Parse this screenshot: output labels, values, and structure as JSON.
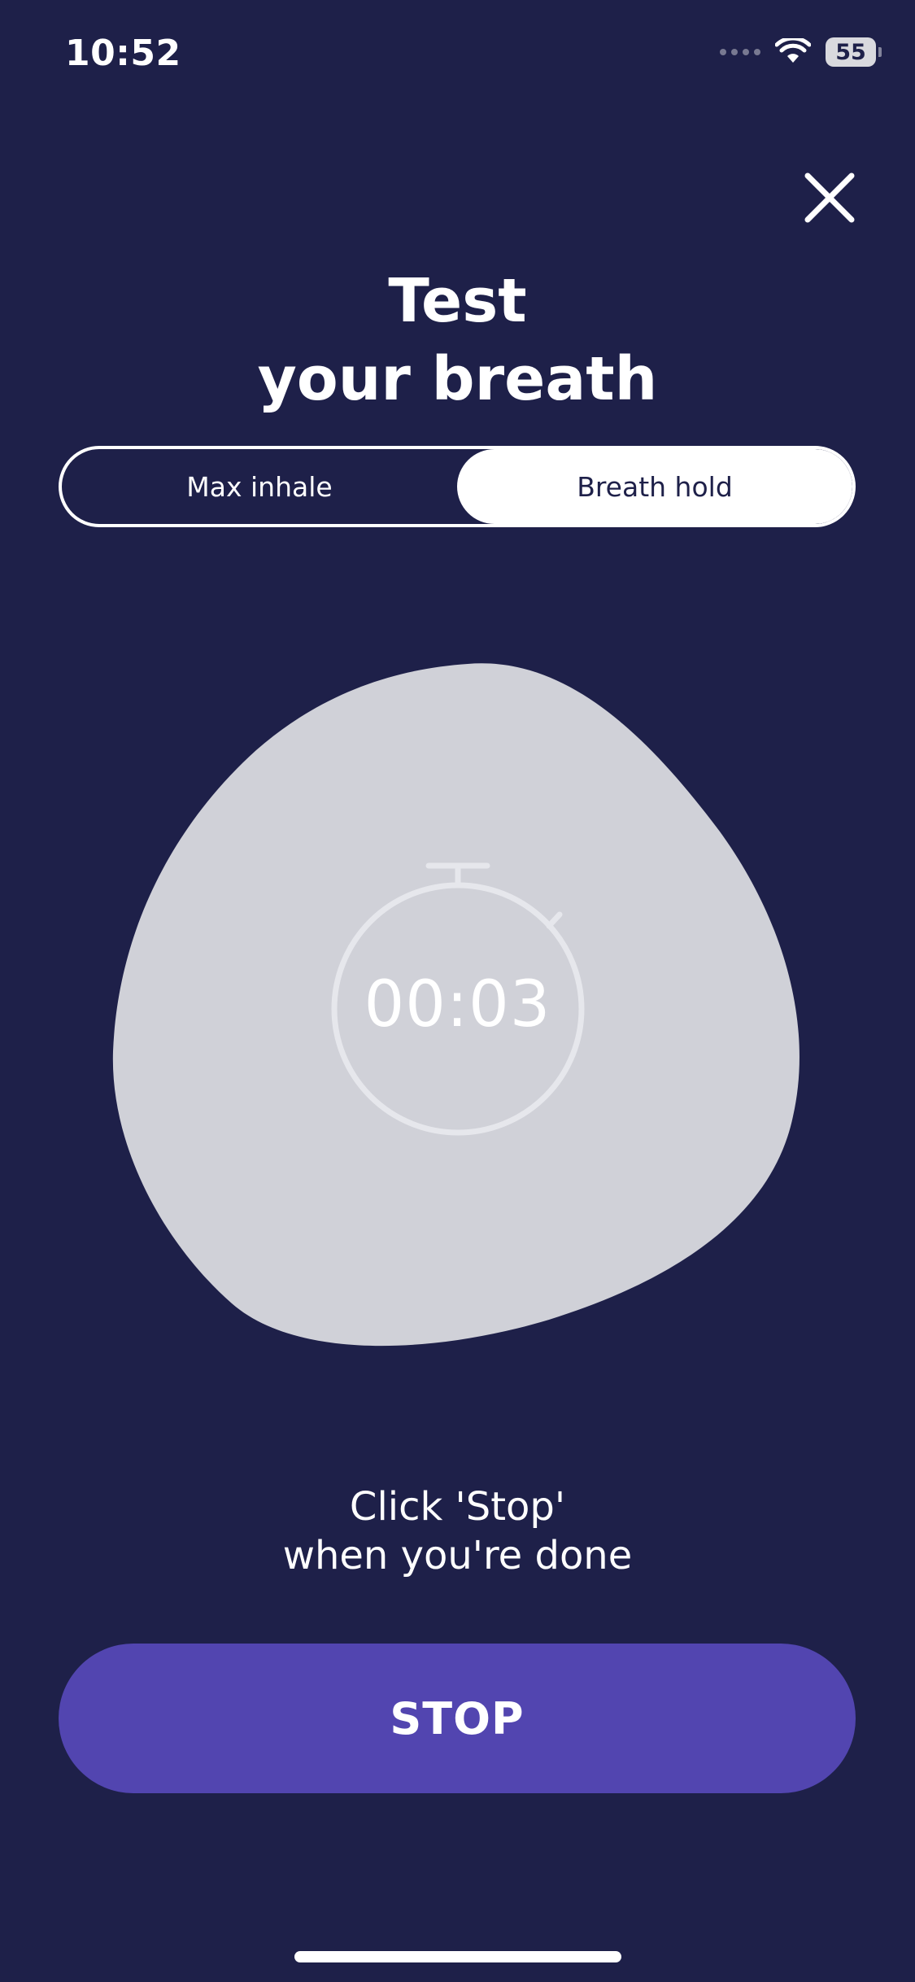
{
  "status_bar": {
    "time": "10:52",
    "battery_level": "55",
    "wifi_icon": "wifi-icon",
    "signal_icon": "cellular-signal-icon"
  },
  "header": {
    "close_icon": "close-icon",
    "title_line1": "Test",
    "title_line2": "your breath"
  },
  "tabs": {
    "items": [
      {
        "label": "Max inhale",
        "active": false
      },
      {
        "label": "Breath hold",
        "active": true
      }
    ]
  },
  "timer": {
    "value": "00:03",
    "icon": "stopwatch-icon"
  },
  "instruction": {
    "line1": "Click 'Stop'",
    "line2": "when you're done"
  },
  "action": {
    "stop_label": "STOP"
  },
  "colors": {
    "background": "#1e2049",
    "blob": "#d0d1d8",
    "accent": "#5245b0",
    "text": "#ffffff"
  }
}
